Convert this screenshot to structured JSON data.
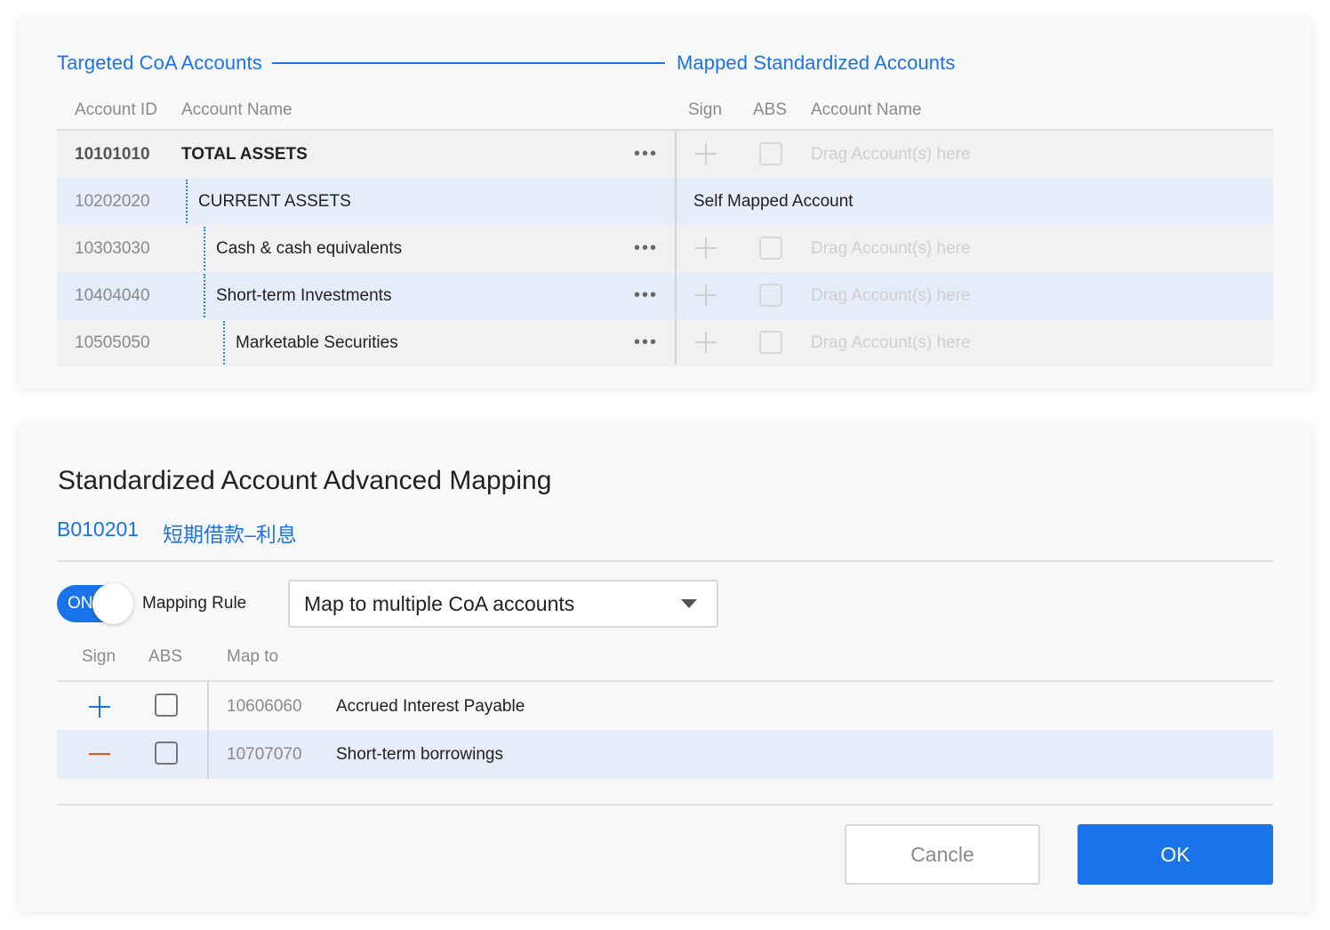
{
  "mapping_table": {
    "left_title": "Targeted CoA Accounts",
    "right_title": "Mapped Standardized Accounts",
    "headers": {
      "account_id": "Account ID",
      "account_name": "Account Name",
      "sign": "Sign",
      "abs": "ABS",
      "mapped_account_name": "Account Name"
    },
    "rows": [
      {
        "id": "10101010",
        "name": "TOTAL ASSETS",
        "more": "•••",
        "placeholder": "Drag Account(s) here",
        "self_mapped": ""
      },
      {
        "id": "10202020",
        "name": "CURRENT ASSETS",
        "more": "",
        "placeholder": "",
        "self_mapped": "Self Mapped Account"
      },
      {
        "id": "10303030",
        "name": "Cash & cash equivalents",
        "more": "•••",
        "placeholder": "Drag Account(s) here",
        "self_mapped": ""
      },
      {
        "id": "10404040",
        "name": "Short-term Investments",
        "more": "•••",
        "placeholder": "Drag Account(s) here",
        "self_mapped": ""
      },
      {
        "id": "10505050",
        "name": "Marketable Securities",
        "more": "•••",
        "placeholder": "Drag Account(s) here",
        "self_mapped": ""
      }
    ]
  },
  "dialog": {
    "title": "Standardized Account Advanced Mapping",
    "account_code": "B010201",
    "account_name_cn": "短期借款–利息",
    "toggle_label": "ON",
    "toggle_on": true,
    "rule_label": "Mapping Rule",
    "rule_value": "Map to multiple CoA accounts",
    "headers": {
      "sign": "Sign",
      "abs": "ABS",
      "map_to": "Map to"
    },
    "mappings": [
      {
        "sign": "plus",
        "abs": false,
        "id": "10606060",
        "name": "Accrued Interest Payable"
      },
      {
        "sign": "minus",
        "abs": false,
        "id": "10707070",
        "name": "Short-term borrowings"
      }
    ],
    "cancel_label": "Cancle",
    "ok_label": "OK"
  },
  "colors": {
    "accent": "#1a73e8",
    "minus": "#f4511e",
    "highlight_row": "#e5edf8"
  }
}
